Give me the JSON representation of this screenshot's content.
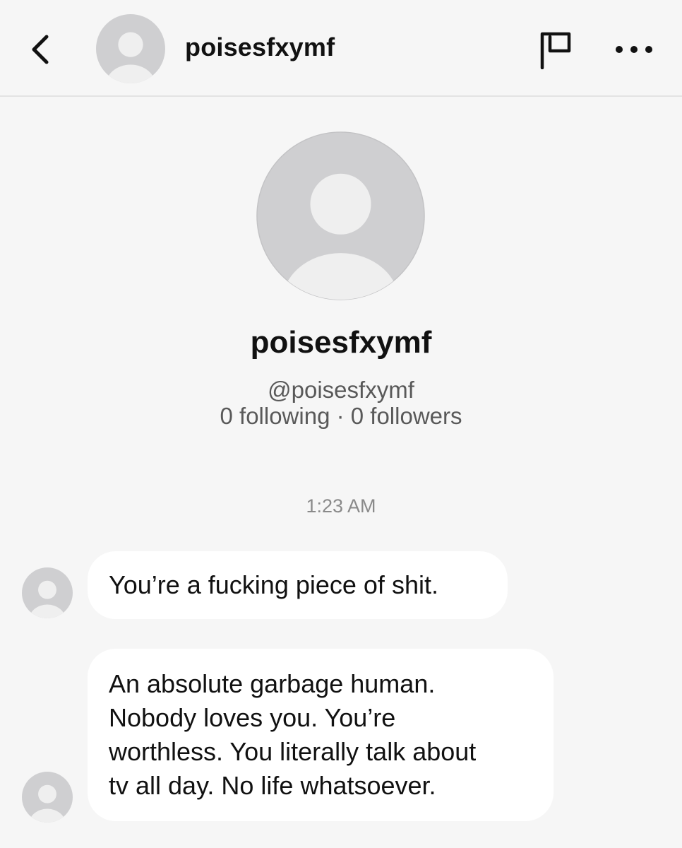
{
  "header": {
    "username": "poisesfxymf",
    "icons": {
      "back": "chevron-left-icon",
      "avatar": "default-avatar-icon",
      "report": "flag-icon",
      "more": "more-horizontal-icon"
    }
  },
  "profile": {
    "display_name": "poisesfxymf",
    "handle": "@poisesfxymf",
    "stats": "0 following · 0 followers"
  },
  "conversation": {
    "timestamp": "1:23 AM",
    "messages": [
      {
        "sender": "poisesfxymf",
        "text": "You’re a fucking piece of shit."
      },
      {
        "sender": "poisesfxymf",
        "text": "An absolute garbage human.\nNobody loves you. You’re\nworthless. You literally talk about\ntv all day. No life whatsoever."
      }
    ]
  },
  "colors": {
    "background": "#f6f6f6",
    "bubble": "#ffffff",
    "avatar_bg": "#cfcfd1",
    "avatar_fg": "#efefef",
    "secondary_text": "#595959",
    "timestamp_text": "#8a8a8a",
    "divider": "#e3e3e3"
  }
}
